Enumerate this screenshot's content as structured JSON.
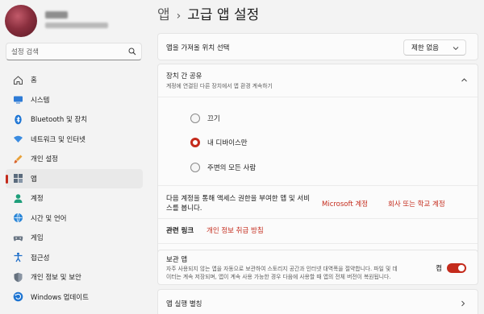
{
  "breadcrumb": {
    "parent": "앱",
    "separator": "›",
    "current": "고급 앱 설정"
  },
  "search": {
    "placeholder": "설정 검색",
    "icon": "search-icon"
  },
  "sidebar": {
    "items": [
      {
        "label": "홈",
        "icon": "home-icon"
      },
      {
        "label": "시스템",
        "icon": "monitor-icon"
      },
      {
        "label": "Bluetooth 및 장치",
        "icon": "bluetooth-icon"
      },
      {
        "label": "네트워크 및 인터넷",
        "icon": "wifi-icon"
      },
      {
        "label": "개인 설정",
        "icon": "paintbrush-icon"
      },
      {
        "label": "앱",
        "icon": "apps-icon",
        "active": true
      },
      {
        "label": "계정",
        "icon": "person-icon"
      },
      {
        "label": "시간 및 언어",
        "icon": "globe-clock-icon"
      },
      {
        "label": "게임",
        "icon": "gamepad-icon"
      },
      {
        "label": "접근성",
        "icon": "accessibility-icon"
      },
      {
        "label": "개인 정보 및 보안",
        "icon": "shield-icon"
      },
      {
        "label": "Windows 업데이트",
        "icon": "update-icon"
      }
    ]
  },
  "main": {
    "app_source": {
      "label": "앱을 가져올 위치 선택",
      "value": "제한 없음"
    },
    "share": {
      "title": "장치 간 공유",
      "subtitle": "계정에 연결된 다른 장치에서 앱 환경 계속하기",
      "options": [
        "끄기",
        "내 디바이스만",
        "주변의 모든 사람"
      ],
      "selected_index": 1
    },
    "accounts": {
      "text_line1": "다음 계정을 통해 액세스 권한을 부여한 앱 및 서비",
      "text_line2": "스를 봅니다.",
      "link_ms": "Microsoft 계정",
      "link_work": "회사 또는 학교 계정"
    },
    "related": {
      "label": "관련 링크",
      "link": "개인 정보 취급 방침"
    },
    "archive": {
      "title": "보관 앱",
      "desc_line1": "자주 사용되지 않는 앱을 자동으로 보관하여 스토리지 공간과 인터넷 대역폭을 절약합니다. 파일 및 데",
      "desc_line2": "이터는 계속 저장되며, 앱이 계속 사용 가능한 경우 다음에 사용할 때 앱의 전체 버전이 복원됩니다.",
      "toggle_label": "켬",
      "toggle_on": true
    },
    "exec_alias": {
      "label": "앱 실행 별칭"
    }
  },
  "colors": {
    "accent": "#c42b1c",
    "background": "#f3f3f3",
    "card": "#fbfbfb"
  }
}
